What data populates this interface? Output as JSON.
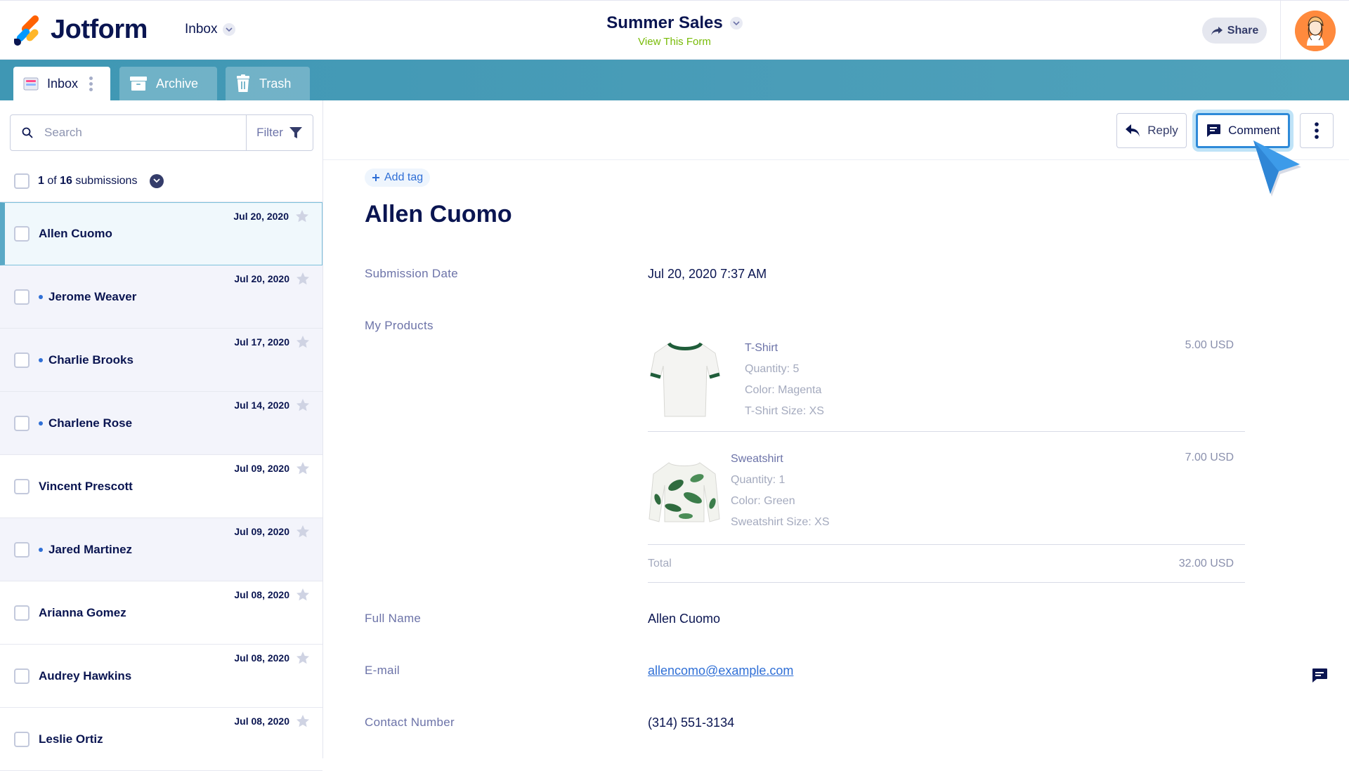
{
  "header": {
    "logo_text": "Jotform",
    "inbox_dropdown": "Inbox",
    "form_title": "Summer Sales",
    "view_form_link": "View This Form",
    "share_label": "Share"
  },
  "tabs": [
    {
      "label": "Inbox",
      "icon": "inbox-icon",
      "active": true
    },
    {
      "label": "Archive",
      "icon": "archive-icon",
      "active": false
    },
    {
      "label": "Trash",
      "icon": "trash-icon",
      "active": false
    }
  ],
  "search": {
    "placeholder": "Search",
    "filter_label": "Filter"
  },
  "submission_count": {
    "current": "1",
    "of": "of",
    "total": "16",
    "suffix": "submissions"
  },
  "submissions": [
    {
      "name": "Allen Cuomo",
      "date": "Jul 20, 2020",
      "unread": false,
      "selected": true
    },
    {
      "name": "Jerome Weaver",
      "date": "Jul 20, 2020",
      "unread": true,
      "selected": false
    },
    {
      "name": "Charlie Brooks",
      "date": "Jul 17, 2020",
      "unread": true,
      "selected": false
    },
    {
      "name": "Charlene Rose",
      "date": "Jul 14, 2020",
      "unread": true,
      "selected": false
    },
    {
      "name": "Vincent Prescott",
      "date": "Jul 09, 2020",
      "unread": false,
      "selected": false
    },
    {
      "name": "Jared Martinez",
      "date": "Jul 09, 2020",
      "unread": true,
      "selected": false
    },
    {
      "name": "Arianna Gomez",
      "date": "Jul 08, 2020",
      "unread": false,
      "selected": false
    },
    {
      "name": "Audrey Hawkins",
      "date": "Jul 08, 2020",
      "unread": false,
      "selected": false
    },
    {
      "name": "Leslie Ortiz",
      "date": "Jul 08, 2020",
      "unread": false,
      "selected": false
    }
  ],
  "toolbar": {
    "reply_label": "Reply",
    "comment_label": "Comment"
  },
  "detail": {
    "add_tag": "Add tag",
    "name": "Allen Cuomo",
    "submission_date_label": "Submission Date",
    "submission_date": "Jul 20, 2020 7:37 AM",
    "products_label": "My Products",
    "products": [
      {
        "name": "T-Shirt",
        "quantity": "Quantity: 5",
        "color": "Color: Magenta",
        "size": "T-Shirt Size: XS",
        "price": "5.00 USD"
      },
      {
        "name": "Sweatshirt",
        "quantity": "Quantity: 1",
        "color": "Color: Green",
        "size": "Sweatshirt Size: XS",
        "price": "7.00 USD"
      }
    ],
    "total_label": "Total",
    "total_value": "32.00 USD",
    "full_name_label": "Full Name",
    "full_name": "Allen Cuomo",
    "email_label": "E-mail",
    "email": "allencomo@example.com",
    "contact_label": "Contact Number",
    "contact": "(314) 551-3134"
  },
  "colors": {
    "navy": "#0a1551",
    "tabbar": "#4a9db8",
    "accent_blue": "#2f6fd6",
    "view_form_green": "#78bb07",
    "comment_border": "#2e8ad8"
  }
}
